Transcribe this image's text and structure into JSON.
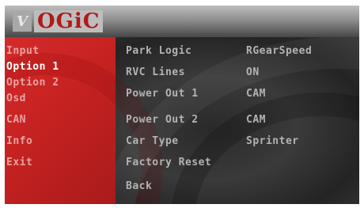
{
  "logo": {
    "badge": "V",
    "text": "OGiC"
  },
  "menu": {
    "items": [
      {
        "label": "Input"
      },
      {
        "label": "Option 1"
      },
      {
        "label": "Option 2"
      },
      {
        "label": "Osd"
      },
      {
        "label": "CAN"
      },
      {
        "label": "Info"
      },
      {
        "label": "Exit"
      }
    ],
    "selected_index": 1
  },
  "settings": {
    "rows": [
      {
        "label": "Park Logic",
        "value": "RGearSpeed"
      },
      {
        "label": "RVC Lines",
        "value": "ON"
      },
      {
        "label": "Power Out 1",
        "value": "CAM"
      },
      {
        "label": "Power Out 2",
        "value": "CAM"
      },
      {
        "label": "Car Type",
        "value": "Sprinter"
      },
      {
        "label": "Factory Reset",
        "value": ""
      },
      {
        "label": "Back",
        "value": ""
      }
    ]
  },
  "colors": {
    "menu_panel": "#c82222",
    "selected_text": "#ffffff",
    "menu_text": "#e7a3a3",
    "settings_text": "#b3b3b3"
  }
}
